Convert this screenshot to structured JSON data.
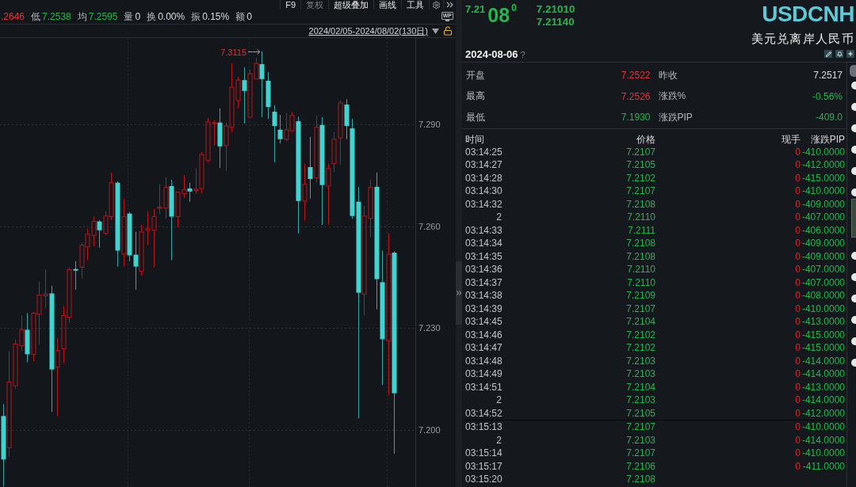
{
  "chart_toolbar": {
    "items": [
      {
        "label": "F9",
        "disabled": false
      },
      {
        "label": "复权",
        "disabled": true
      },
      {
        "label": "超级叠加",
        "disabled": false
      },
      {
        "label": "画线",
        "disabled": false
      },
      {
        "label": "工具",
        "disabled": false
      }
    ]
  },
  "stats_bar": {
    "items": [
      {
        "value": ".2646",
        "color": "#e2353b"
      },
      {
        "label": "低",
        "value": "7.2538",
        "color": "#24b84c"
      },
      {
        "label": "均",
        "value": "7.2595",
        "color": "#24b84c"
      },
      {
        "label": "量",
        "value": "0"
      },
      {
        "label": "换",
        "value": "0.00%"
      },
      {
        "label": "振",
        "value": "0.15%"
      },
      {
        "label": "额",
        "value": "0"
      }
    ],
    "screen_button": "WP"
  },
  "range_bar": {
    "date_range": "2024/02/05-2024/08/02(130日)"
  },
  "chart": {
    "chart_data": {
      "type": "candlestick",
      "grid": true,
      "categories": [
        null,
        null,
        null,
        null,
        null,
        null,
        null,
        null,
        null,
        null,
        null,
        null,
        null,
        null,
        null,
        null,
        null,
        null,
        null,
        null,
        null,
        null,
        null,
        null,
        null,
        null,
        null,
        null,
        null,
        null,
        null,
        null,
        null,
        null,
        null,
        null,
        null,
        null,
        null,
        null,
        null,
        null,
        null,
        null,
        null,
        null,
        null,
        null,
        null,
        null,
        null,
        null,
        null,
        null,
        null,
        null,
        null,
        null,
        null,
        null,
        null,
        null,
        null,
        null,
        null,
        null,
        null,
        null,
        null
      ],
      "ohlc": [
        [
          7.2041,
          7.2076,
          7.1834,
          7.1913
        ],
        [
          7.1948,
          7.2232,
          7.192,
          7.2141
        ],
        [
          7.213,
          7.2267,
          7.2122,
          7.2253
        ],
        [
          7.2248,
          7.2337,
          7.2234,
          7.2295
        ],
        [
          7.2295,
          7.2344,
          7.2199,
          7.2223
        ],
        [
          7.2223,
          7.2348,
          7.2202,
          7.2344
        ],
        [
          7.2341,
          7.2437,
          7.2251,
          7.2397
        ],
        [
          7.2395,
          7.2472,
          7.2358,
          7.24
        ],
        [
          7.2402,
          7.2425,
          7.2053,
          7.2178
        ],
        [
          7.2185,
          7.2271,
          7.2041,
          7.2234
        ],
        [
          7.2239,
          7.2365,
          7.2197,
          7.2337
        ],
        [
          7.2332,
          7.2479,
          7.2316,
          7.2472
        ],
        [
          7.2474,
          7.2497,
          7.2413,
          7.2469
        ],
        [
          7.2479,
          7.2551,
          7.2446,
          7.2544
        ],
        [
          7.2539,
          7.2593,
          7.25,
          7.2576
        ],
        [
          7.2572,
          7.2628,
          7.2541,
          7.2614
        ],
        [
          7.2614,
          7.2618,
          7.2537,
          7.2588
        ],
        [
          7.2579,
          7.2644,
          7.2574,
          7.263
        ],
        [
          7.2628,
          7.2758,
          7.2618,
          7.2728
        ],
        [
          7.2728,
          7.2732,
          7.2481,
          7.2528
        ],
        [
          7.2518,
          7.2681,
          7.2481,
          7.2628
        ],
        [
          7.2637,
          7.2642,
          7.2497,
          7.2514
        ],
        [
          7.2516,
          7.2583,
          7.2413,
          7.2481
        ],
        [
          7.2467,
          7.2604,
          7.2455,
          7.2583
        ],
        [
          7.2588,
          7.2644,
          7.2544,
          7.2593
        ],
        [
          7.2588,
          7.2651,
          7.2479,
          7.2628
        ],
        [
          7.2653,
          7.2723,
          7.2635,
          7.2656
        ],
        [
          7.2653,
          7.2744,
          7.2621,
          7.2714
        ],
        [
          7.2718,
          7.2737,
          7.25,
          7.2628
        ],
        [
          7.2628,
          7.2702,
          7.2597,
          7.27
        ],
        [
          7.2695,
          7.2751,
          7.2683,
          7.2707
        ],
        [
          7.2711,
          7.2728,
          7.2672,
          7.2702
        ],
        [
          7.2705,
          7.277,
          7.2695,
          7.2709
        ],
        [
          7.2711,
          7.2818,
          7.2698,
          7.2811
        ],
        [
          7.2793,
          7.2919,
          7.2788,
          7.2907
        ],
        [
          7.2902,
          7.2912,
          7.2837,
          7.2905
        ],
        [
          7.2905,
          7.2947,
          7.2772,
          7.2835
        ],
        [
          7.2837,
          7.2905,
          7.2763,
          7.2895
        ],
        [
          7.2891,
          7.3079,
          7.2877,
          7.3009
        ],
        [
          7.297,
          7.304,
          7.2947,
          7.303
        ],
        [
          7.303,
          7.3068,
          7.2902,
          7.2998
        ],
        [
          7.2921,
          7.3061,
          7.2921,
          7.3049
        ],
        [
          7.3033,
          7.3095,
          7.3033,
          7.3079
        ],
        [
          7.3077,
          7.3115,
          7.2921,
          7.3033
        ],
        [
          7.3028,
          7.3054,
          7.2916,
          7.2951
        ],
        [
          7.2937,
          7.2956,
          7.2788,
          7.2895
        ],
        [
          7.2884,
          7.2928,
          7.2844,
          7.2856
        ],
        [
          7.2856,
          7.2933,
          7.2849,
          7.2884
        ],
        [
          7.2881,
          7.2937,
          7.2877,
          7.2926
        ],
        [
          7.2909,
          7.2923,
          7.2579,
          7.2674
        ],
        [
          7.2674,
          7.2784,
          7.2616,
          7.2723
        ],
        [
          7.2774,
          7.2863,
          7.2681,
          7.2739
        ],
        [
          7.2742,
          7.2926,
          7.2728,
          7.2891
        ],
        [
          7.2898,
          7.2921,
          7.2604,
          7.2721
        ],
        [
          7.2718,
          7.2784,
          7.2604,
          7.277
        ],
        [
          7.2784,
          7.2877,
          7.276,
          7.2856
        ],
        [
          7.286,
          7.297,
          7.2781,
          7.2963
        ],
        [
          7.2958,
          7.2974,
          7.2856,
          7.2895
        ],
        [
          7.2888,
          7.2916,
          7.2621,
          7.263
        ],
        [
          7.2672,
          7.2716,
          7.2034,
          7.2404
        ],
        [
          7.24,
          7.266,
          7.2337,
          7.263
        ],
        [
          7.2623,
          7.2737,
          7.2567,
          7.2714
        ],
        [
          7.2716,
          7.2758,
          7.2355,
          7.2444
        ],
        [
          7.2435,
          7.2528,
          7.2132,
          7.2267
        ],
        [
          7.2262,
          7.2579,
          7.2102,
          7.2517
        ],
        [
          7.2522,
          7.2526,
          7.193,
          7.2108
        ],
        null,
        null,
        null
      ],
      "ylim": [
        7.1832,
        7.3154
      ],
      "yticks": [
        {
          "value": 7.29,
          "label": "7.290"
        },
        {
          "value": 7.26,
          "label": "7.260"
        },
        {
          "value": 7.23,
          "label": "7.230"
        },
        {
          "value": 7.2,
          "label": "7.200"
        }
      ],
      "annotations": [
        "7.3115"
      ]
    }
  },
  "quote": {
    "price_head": "7.21",
    "price_main": "08",
    "price_tail": "0",
    "side_prices": [
      "7.21010",
      "7.21140"
    ]
  },
  "instrument": {
    "symbol": "USDCNH",
    "name": "美元兑离岸人民币",
    "date": "2024-08-06",
    "help": "?"
  },
  "summary": [
    {
      "label": "开盘",
      "value": "7.2522",
      "color": "#e2353b"
    },
    {
      "label": "昨收",
      "value": "7.2517"
    },
    {
      "label": "最高",
      "value": "7.2526",
      "color": "#e2353b"
    },
    {
      "label": "涨跌%",
      "value": "-0.56%",
      "color": "#24b84c"
    },
    {
      "label": "最低",
      "value": "7.1930",
      "color": "#24b84c"
    },
    {
      "label": "涨跌PIP",
      "value": "-409.0",
      "color": "#24b84c"
    }
  ],
  "ticks": {
    "columns": [
      "时间",
      "价格",
      "现手",
      "涨跌PIP"
    ],
    "groups": [
      {
        "rows": [
          {
            "time": "03:14:25",
            "price": "7.2107",
            "volume": "0",
            "change": "-410.0000"
          },
          {
            "time": "03:14:27",
            "price": "7.2105",
            "volume": "0",
            "change": "-412.0000"
          },
          {
            "time": "03:14:28",
            "price": "7.2102",
            "volume": "0",
            "change": "-415.0000"
          },
          {
            "time": "03:14:30",
            "price": "7.2107",
            "volume": "0",
            "change": "-410.0000"
          },
          {
            "time": "03:14:32",
            "price": "7.2108",
            "volume": "0",
            "change": "-409.0000"
          },
          {
            "time": "2",
            "price": "7.2110",
            "volume": "0",
            "change": "-407.0000"
          },
          {
            "time": "03:14:33",
            "price": "7.2111",
            "volume": "0",
            "change": "-406.0000"
          },
          {
            "time": "03:14:34",
            "price": "7.2108",
            "volume": "0",
            "change": "-409.0000"
          },
          {
            "time": "03:14:35",
            "price": "7.2108",
            "volume": "0",
            "change": "-409.0000"
          },
          {
            "time": "03:14:36",
            "price": "7.2110",
            "volume": "0",
            "change": "-407.0000"
          },
          {
            "time": "03:14:37",
            "price": "7.2110",
            "volume": "0",
            "change": "-407.0000"
          },
          {
            "time": "03:14:38",
            "price": "7.2109",
            "volume": "0",
            "change": "-408.0000"
          },
          {
            "time": "03:14:39",
            "price": "7.2107",
            "volume": "0",
            "change": "-410.0000"
          },
          {
            "time": "03:14:45",
            "price": "7.2104",
            "volume": "0",
            "change": "-413.0000"
          },
          {
            "time": "03:14:46",
            "price": "7.2102",
            "volume": "0",
            "change": "-415.0000"
          },
          {
            "time": "03:14:47",
            "price": "7.2102",
            "volume": "0",
            "change": "-415.0000"
          },
          {
            "time": "03:14:48",
            "price": "7.2103",
            "volume": "0",
            "change": "-414.0000"
          },
          {
            "time": "03:14:49",
            "price": "7.2103",
            "volume": "0",
            "change": "-414.0000"
          },
          {
            "time": "03:14:51",
            "price": "7.2104",
            "volume": "0",
            "change": "-413.0000"
          },
          {
            "time": "2",
            "price": "7.2103",
            "volume": "0",
            "change": "-414.0000"
          },
          {
            "time": "03:14:52",
            "price": "7.2105",
            "volume": "0",
            "change": "-412.0000"
          }
        ]
      },
      {
        "rows": [
          {
            "time": "03:15:13",
            "price": "7.2107",
            "volume": "0",
            "change": "-410.0000"
          },
          {
            "time": "2",
            "price": "7.2103",
            "volume": "0",
            "change": "-414.0000"
          },
          {
            "time": "03:15:14",
            "price": "7.2107",
            "volume": "0",
            "change": "-410.0000"
          },
          {
            "time": "03:15:17",
            "price": "7.2106",
            "volume": "0",
            "change": "-411.0000"
          },
          {
            "time": "03:15:20",
            "price": "7.2108"
          }
        ]
      }
    ]
  }
}
